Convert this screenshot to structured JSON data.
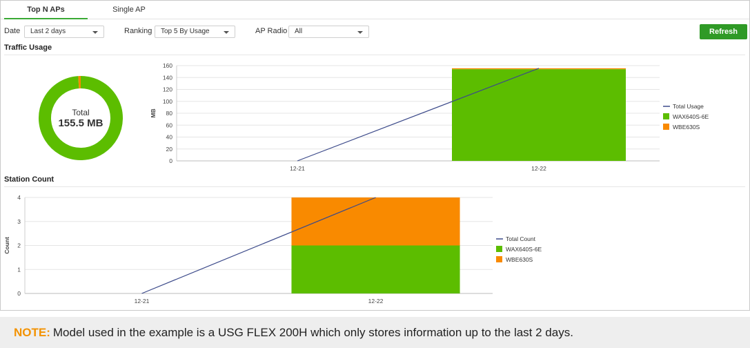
{
  "tabs": [
    {
      "label": "Top N APs",
      "active": true
    },
    {
      "label": "Single AP",
      "active": false
    }
  ],
  "filters": {
    "date_label": "Date",
    "date_value": "Last 2 days",
    "ranking_label": "Ranking",
    "ranking_value": "Top 5 By Usage",
    "radio_label": "AP Radio",
    "radio_value": "All"
  },
  "refresh_label": "Refresh",
  "traffic": {
    "title": "Traffic Usage",
    "donut_label": "Total",
    "donut_value": "155.5 MB"
  },
  "station": {
    "title": "Station Count"
  },
  "colors": {
    "wax": "#5cbd00",
    "wbe": "#f98a00",
    "line": "#3c4a8a",
    "accent": "#2f9a26",
    "note_label": "#f39200"
  },
  "chart_data": [
    {
      "type": "pie",
      "categories": [
        "WAX640S-6E",
        "WBE630S"
      ],
      "values": [
        154.0,
        1.5
      ],
      "center_text": [
        "Total",
        "155.5 MB"
      ]
    },
    {
      "type": "bar",
      "categories": [
        "12-21",
        "12-22"
      ],
      "series": [
        {
          "name": "WAX640S-6E",
          "values": [
            0,
            154
          ],
          "kind": "bar"
        },
        {
          "name": "WBE630S",
          "values": [
            0,
            1.5
          ],
          "kind": "bar"
        },
        {
          "name": "Total Usage",
          "values": [
            0,
            155.5
          ],
          "kind": "line"
        }
      ],
      "ylabel": "MB",
      "ylim": [
        0,
        160
      ],
      "yticks": [
        0,
        20,
        40,
        60,
        80,
        100,
        120,
        140,
        160
      ],
      "legend": "right",
      "grid": true
    },
    {
      "type": "bar",
      "categories": [
        "12-21",
        "12-22"
      ],
      "series": [
        {
          "name": "WAX640S-6E",
          "values": [
            0,
            2
          ],
          "kind": "bar"
        },
        {
          "name": "WBE630S",
          "values": [
            0,
            2
          ],
          "kind": "bar"
        },
        {
          "name": "Total Count",
          "values": [
            0,
            4
          ],
          "kind": "line"
        }
      ],
      "ylabel": "Count",
      "ylim": [
        0,
        4
      ],
      "yticks": [
        0,
        1,
        2,
        3,
        4
      ],
      "legend": "right",
      "grid": true
    }
  ],
  "note": {
    "label": "NOTE:",
    "text": "Model used in the example is a USG FLEX 200H which only stores information up to the last 2 days."
  }
}
